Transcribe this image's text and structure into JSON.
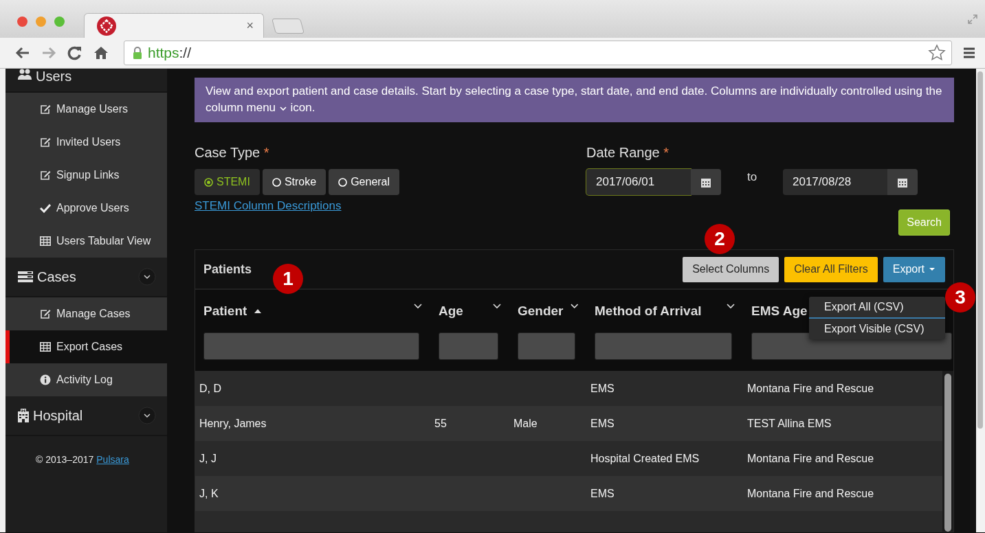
{
  "browser": {
    "tab_close": "×",
    "url_scheme": "https",
    "url_rest": "://"
  },
  "sidebar": {
    "sections": [
      {
        "label": "Users",
        "items": [
          {
            "label": "Manage Users",
            "selected": false
          },
          {
            "label": "Invited Users",
            "selected": false
          },
          {
            "label": "Signup Links",
            "selected": false
          },
          {
            "label": "Approve Users",
            "selected": false
          },
          {
            "label": "Users Tabular View",
            "selected": false
          }
        ]
      },
      {
        "label": "Cases",
        "items": [
          {
            "label": "Manage Cases",
            "selected": false
          },
          {
            "label": "Export Cases",
            "selected": true
          },
          {
            "label": "Activity Log",
            "selected": false
          }
        ]
      },
      {
        "label": "Hospital"
      }
    ],
    "footer": {
      "text": "© 2013–2017",
      "link": "Pulsara"
    }
  },
  "banner": {
    "text_before": "View and export patient and case details. Start by selecting a case type, start date, and end date. Columns are individually controlled using the column menu",
    "text_after": "icon."
  },
  "case_type": {
    "label": "Case Type",
    "required": "*",
    "options": [
      {
        "label": "STEMI",
        "selected": true
      },
      {
        "label": "Stroke",
        "selected": false
      },
      {
        "label": "General",
        "selected": false
      }
    ],
    "link": "STEMI Column Descriptions"
  },
  "date_range": {
    "label": "Date Range",
    "required": "*",
    "start": "2017/06/01",
    "separator": "to",
    "end": "2017/08/28"
  },
  "search_button": "Search",
  "table": {
    "title": "Patients",
    "buttons": [
      {
        "label": "Select Columns",
        "kind": "default"
      },
      {
        "label": "Clear All Filters",
        "kind": "warning"
      },
      {
        "label": "Export",
        "kind": "dropdown"
      }
    ],
    "export_menu": [
      "Export All (CSV)",
      "Export Visible (CSV)"
    ],
    "columns": [
      {
        "label": "Patient",
        "sorted": true
      },
      {
        "label": "Age",
        "sorted": false
      },
      {
        "label": "Gender",
        "sorted": false
      },
      {
        "label": "Method of Arrival",
        "sorted": false
      },
      {
        "label": "EMS Age",
        "sorted": false
      }
    ],
    "rows": [
      {
        "cells": [
          "D, D",
          null,
          null,
          "EMS",
          "Montana Fire and Rescue"
        ]
      },
      {
        "cells": [
          "Henry, James",
          "55",
          "Male",
          "EMS",
          "TEST Allina EMS"
        ]
      },
      {
        "cells": [
          "J, J",
          null,
          null,
          "Hospital Created EMS",
          "Montana Fire and Rescue"
        ]
      },
      {
        "cells": [
          "J, K",
          null,
          null,
          "EMS",
          "Montana Fire and Rescue"
        ]
      }
    ]
  },
  "annotations": [
    "1",
    "2",
    "3"
  ]
}
